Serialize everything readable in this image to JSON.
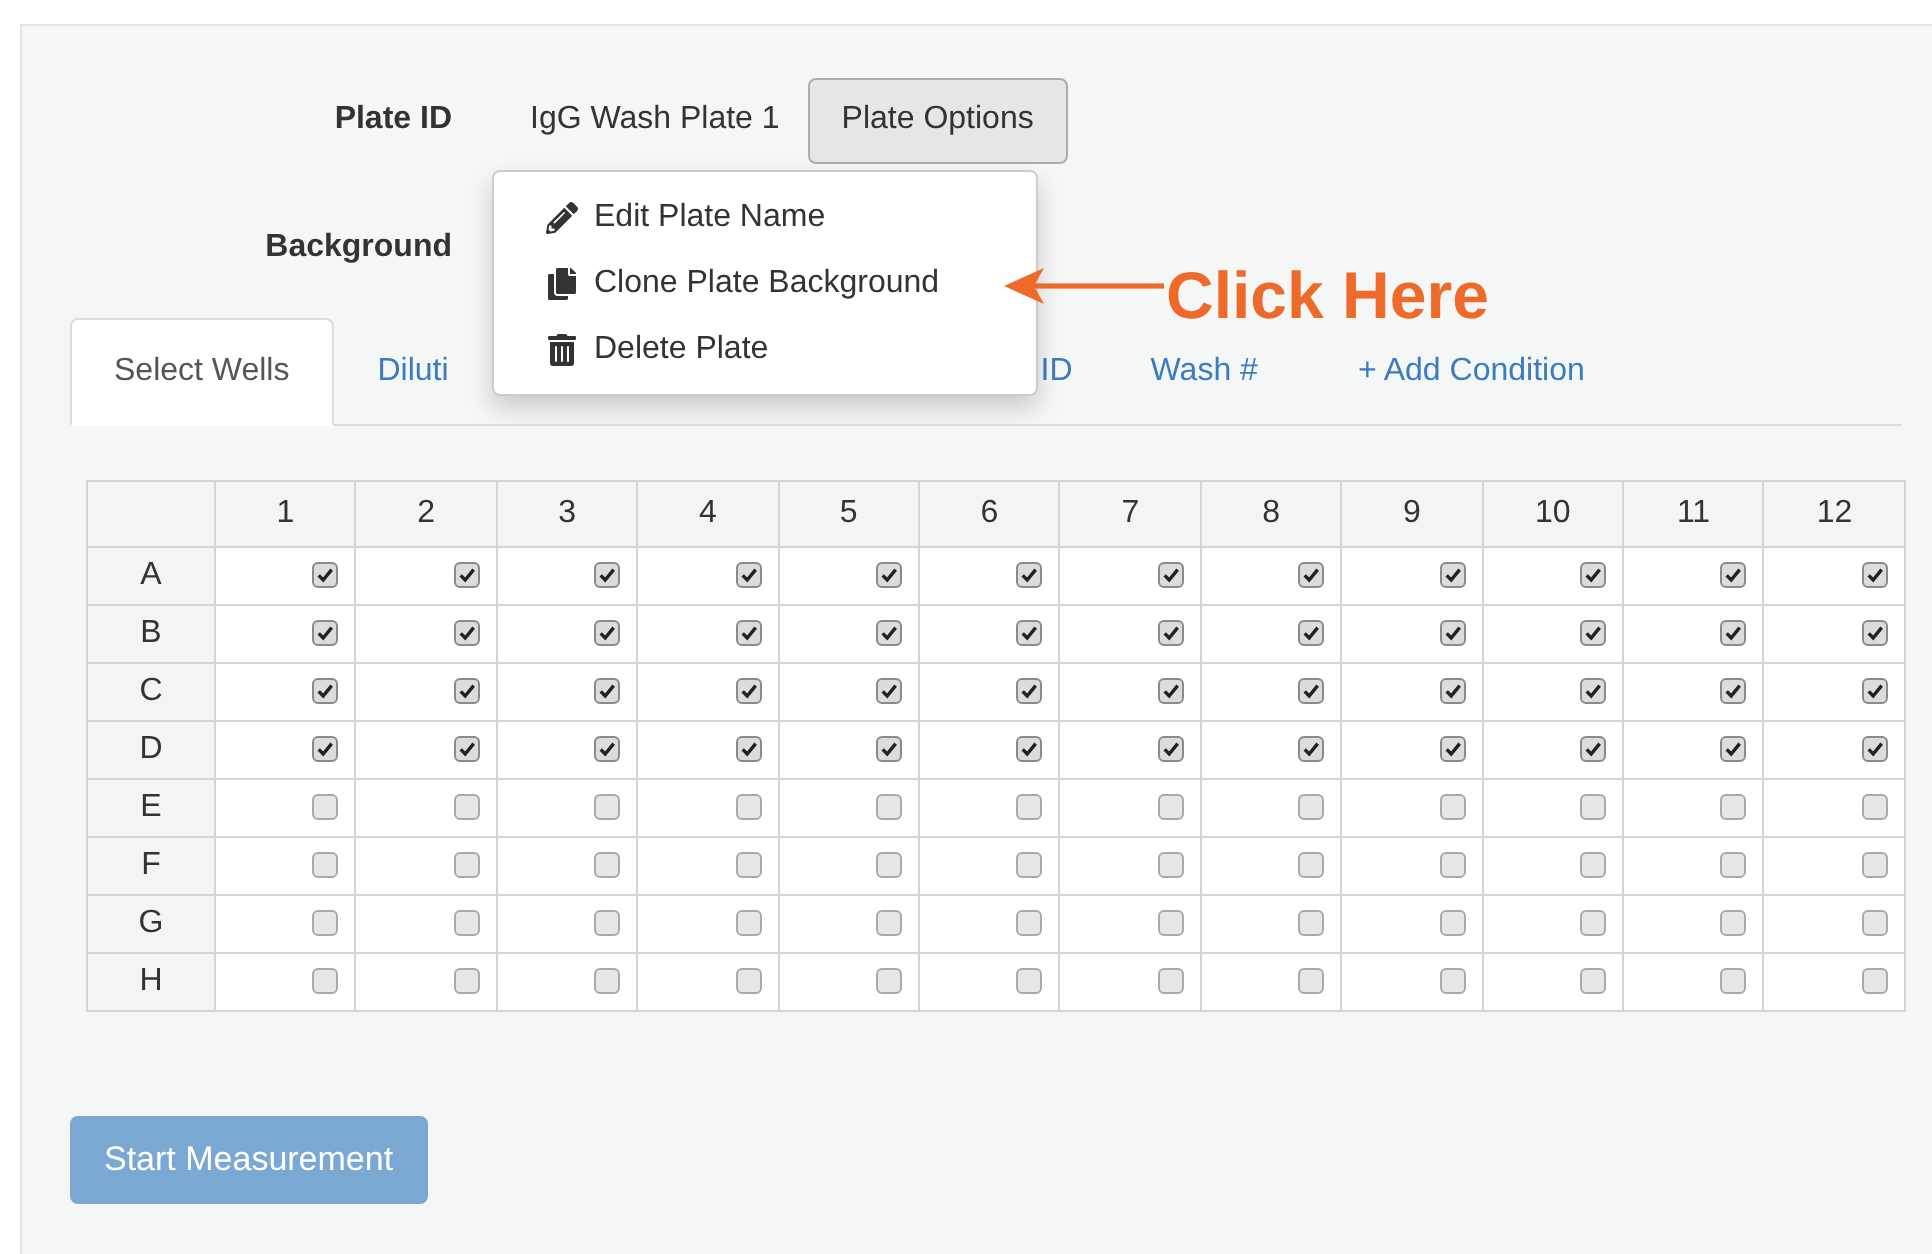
{
  "plate_id": {
    "label": "Plate ID",
    "value": "IgG Wash Plate 1"
  },
  "plate_options_button": "Plate Options",
  "background": {
    "label": "Background"
  },
  "dropdown_menu": [
    {
      "kind": "edit",
      "label": "Edit Plate Name"
    },
    {
      "kind": "clone",
      "label": "Clone Plate Background"
    },
    {
      "kind": "delete",
      "label": "Delete Plate"
    }
  ],
  "callout": "Click Here",
  "tabs": [
    {
      "label": "Select Wells",
      "selected": true
    },
    {
      "label": "Diluti",
      "selected": false
    },
    {
      "label": "ID",
      "selected": false
    },
    {
      "label": "Wash #",
      "selected": false
    },
    {
      "label": "+ Add Condition",
      "selected": false
    }
  ],
  "table": {
    "columns": [
      "1",
      "2",
      "3",
      "4",
      "5",
      "6",
      "7",
      "8",
      "9",
      "10",
      "11",
      "12"
    ],
    "rows": [
      {
        "label": "A",
        "checked": [
          true,
          true,
          true,
          true,
          true,
          true,
          true,
          true,
          true,
          true,
          true,
          true
        ]
      },
      {
        "label": "B",
        "checked": [
          true,
          true,
          true,
          true,
          true,
          true,
          true,
          true,
          true,
          true,
          true,
          true
        ]
      },
      {
        "label": "C",
        "checked": [
          true,
          true,
          true,
          true,
          true,
          true,
          true,
          true,
          true,
          true,
          true,
          true
        ]
      },
      {
        "label": "D",
        "checked": [
          true,
          true,
          true,
          true,
          true,
          true,
          true,
          true,
          true,
          true,
          true,
          true
        ]
      },
      {
        "label": "E",
        "checked": [
          false,
          false,
          false,
          false,
          false,
          false,
          false,
          false,
          false,
          false,
          false,
          false
        ]
      },
      {
        "label": "F",
        "checked": [
          false,
          false,
          false,
          false,
          false,
          false,
          false,
          false,
          false,
          false,
          false,
          false
        ]
      },
      {
        "label": "G",
        "checked": [
          false,
          false,
          false,
          false,
          false,
          false,
          false,
          false,
          false,
          false,
          false,
          false
        ]
      },
      {
        "label": "H",
        "checked": [
          false,
          false,
          false,
          false,
          false,
          false,
          false,
          false,
          false,
          false,
          false,
          false
        ]
      }
    ]
  },
  "start_button": {
    "label": "Start Measurement",
    "disabled": true
  }
}
